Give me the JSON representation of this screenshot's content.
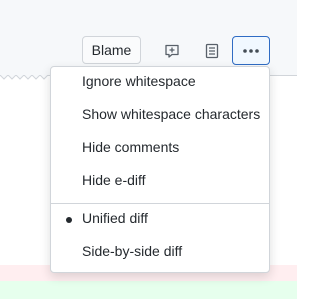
{
  "toolbar": {
    "blame_label": "Blame",
    "icons": {
      "comment": "add-comment-icon",
      "file": "file-text-icon",
      "more": "kebab-horizontal-icon"
    }
  },
  "menu": {
    "items": [
      {
        "label": "Ignore whitespace"
      },
      {
        "label": "Show whitespace characters"
      },
      {
        "label": "Hide comments"
      },
      {
        "label": "Hide e-diff"
      }
    ],
    "view_options": [
      {
        "label": "Unified diff",
        "selected": true
      },
      {
        "label": "Side-by-side diff",
        "selected": false
      }
    ]
  },
  "colors": {
    "accent": "#2f6cc4",
    "diff_removed": "#ffeef0",
    "diff_added": "#e6ffed"
  }
}
